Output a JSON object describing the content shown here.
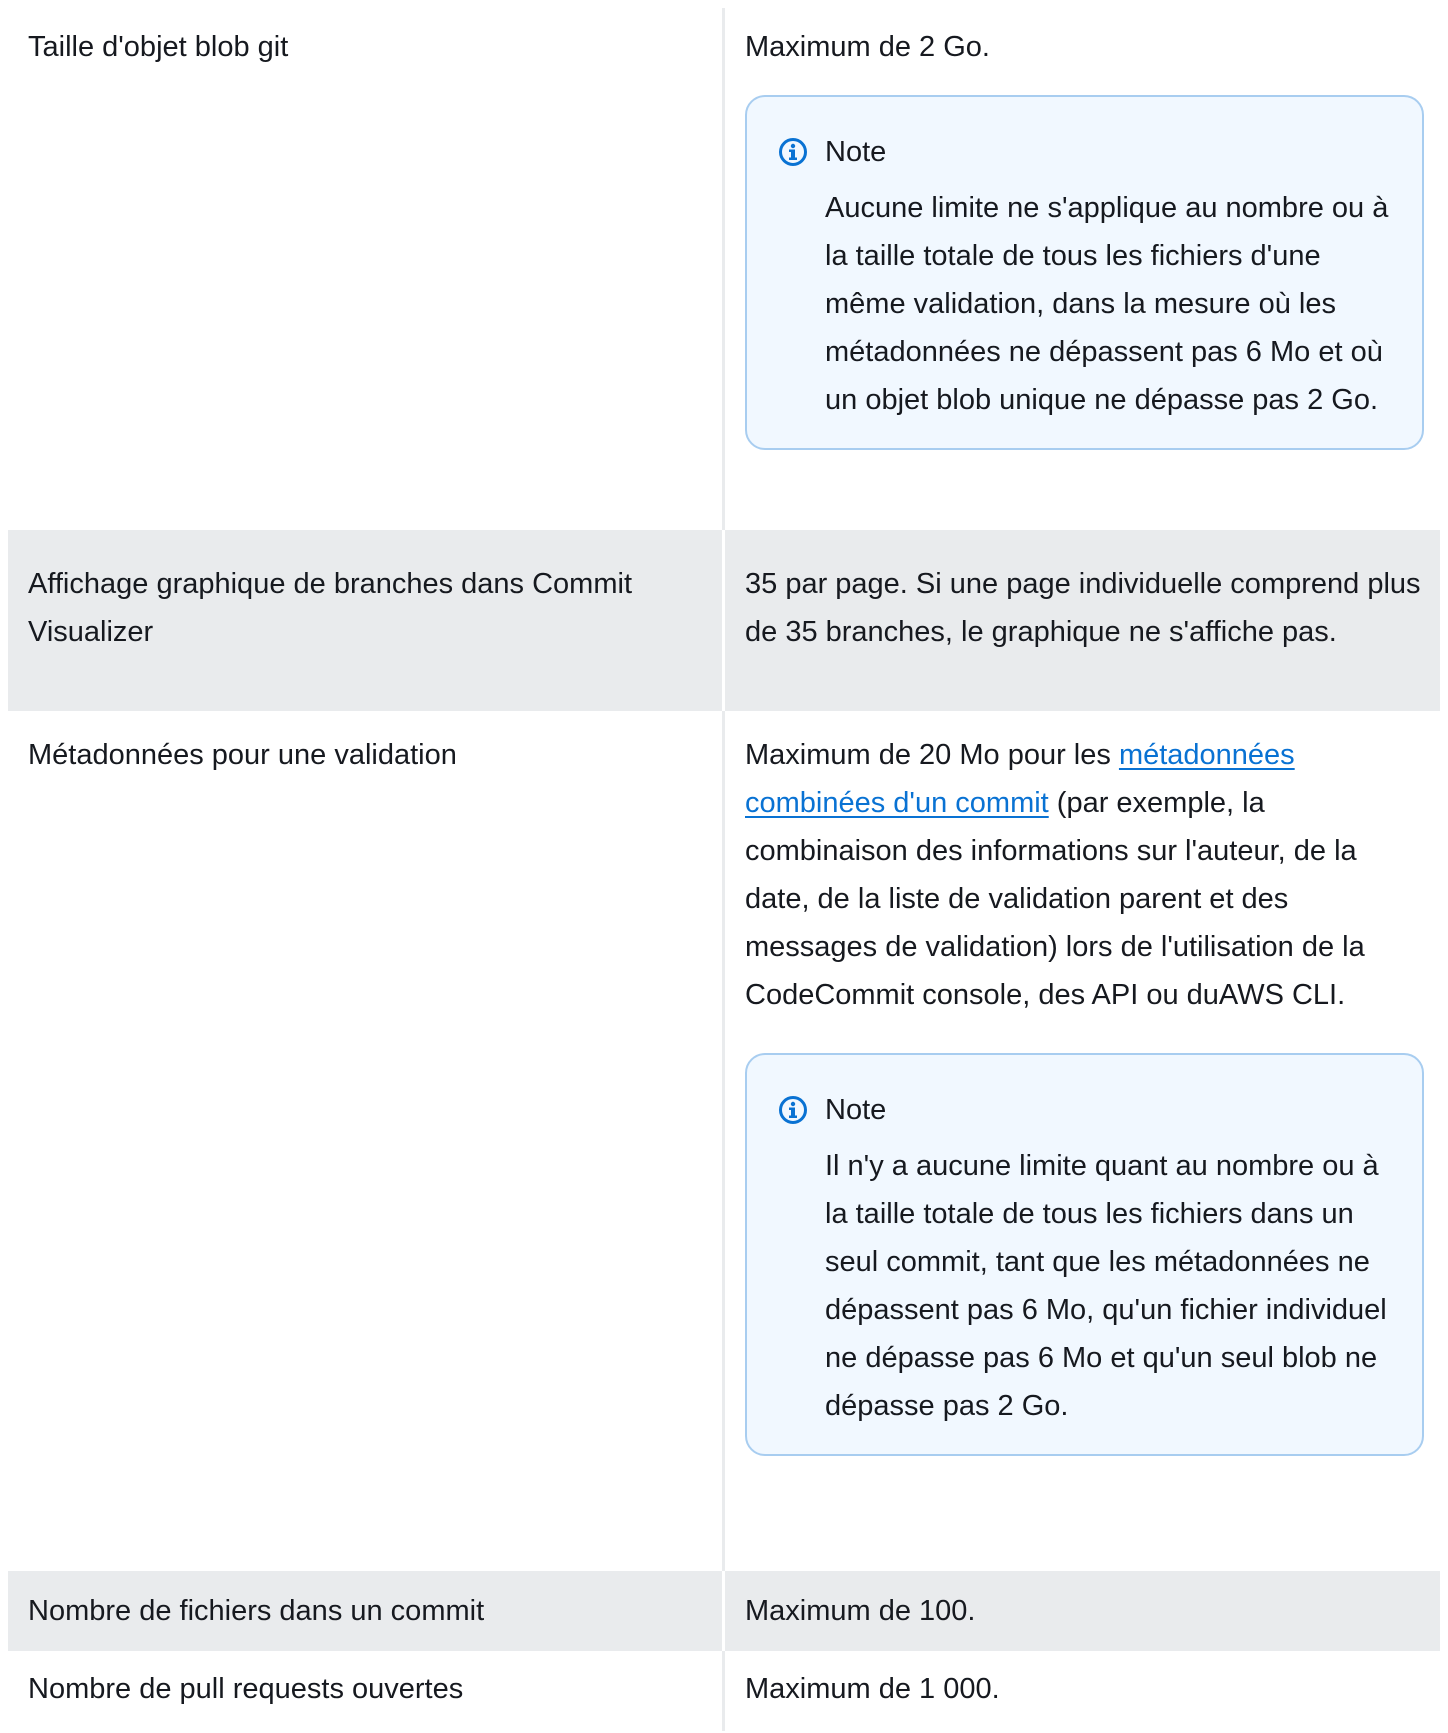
{
  "rows": [
    {
      "name": "Taille d'objet blob git",
      "value": "Maximum de 2 Go.",
      "note": {
        "title": "Note",
        "body": "Aucune limite ne s'applique au nombre ou à la taille totale de tous les fichiers d'une même validation, dans la mesure où les métadonnées ne dépassent pas 6 Mo et où un objet blob unique ne dépasse pas 2 Go."
      }
    },
    {
      "name": "Affichage graphique de branches dans Commit Visualizer",
      "value": "35 par page. Si une page individuelle comprend plus de 35 branches, le graphique ne s'affiche pas."
    },
    {
      "name": "Métadonnées pour une validation",
      "value_prefix": "Maximum de 20 Mo pour les ",
      "value_link": "métadonnées combinées d'un commit",
      "value_suffix": " (par exemple, la combinaison des informations sur l'auteur, de la date, de la liste de validation parent et des messages de validation) lors de l'utilisation de la CodeCommit console, des API ou duAWS CLI.",
      "note": {
        "title": "Note",
        "body": "Il n'y a aucune limite quant au nombre ou à la taille totale de tous les fichiers dans un seul commit, tant que les métadonnées ne dépassent pas 6 Mo, qu'un fichier individuel ne dépasse pas 6 Mo et qu'un seul blob ne dépasse pas 2 Go."
      }
    },
    {
      "name": "Nombre de fichiers dans un commit",
      "value": "Maximum de 100."
    },
    {
      "name": "Nombre de pull requests ouvertes",
      "value": "Maximum de 1 000."
    }
  ],
  "icons": {
    "note": "info-circle-icon"
  },
  "colors": {
    "row_shaded": "#e9ebed",
    "note_background": "#f1f8ff",
    "note_border": "#a8cdf0",
    "link": "#0972d3",
    "icon": "#0972d3"
  }
}
